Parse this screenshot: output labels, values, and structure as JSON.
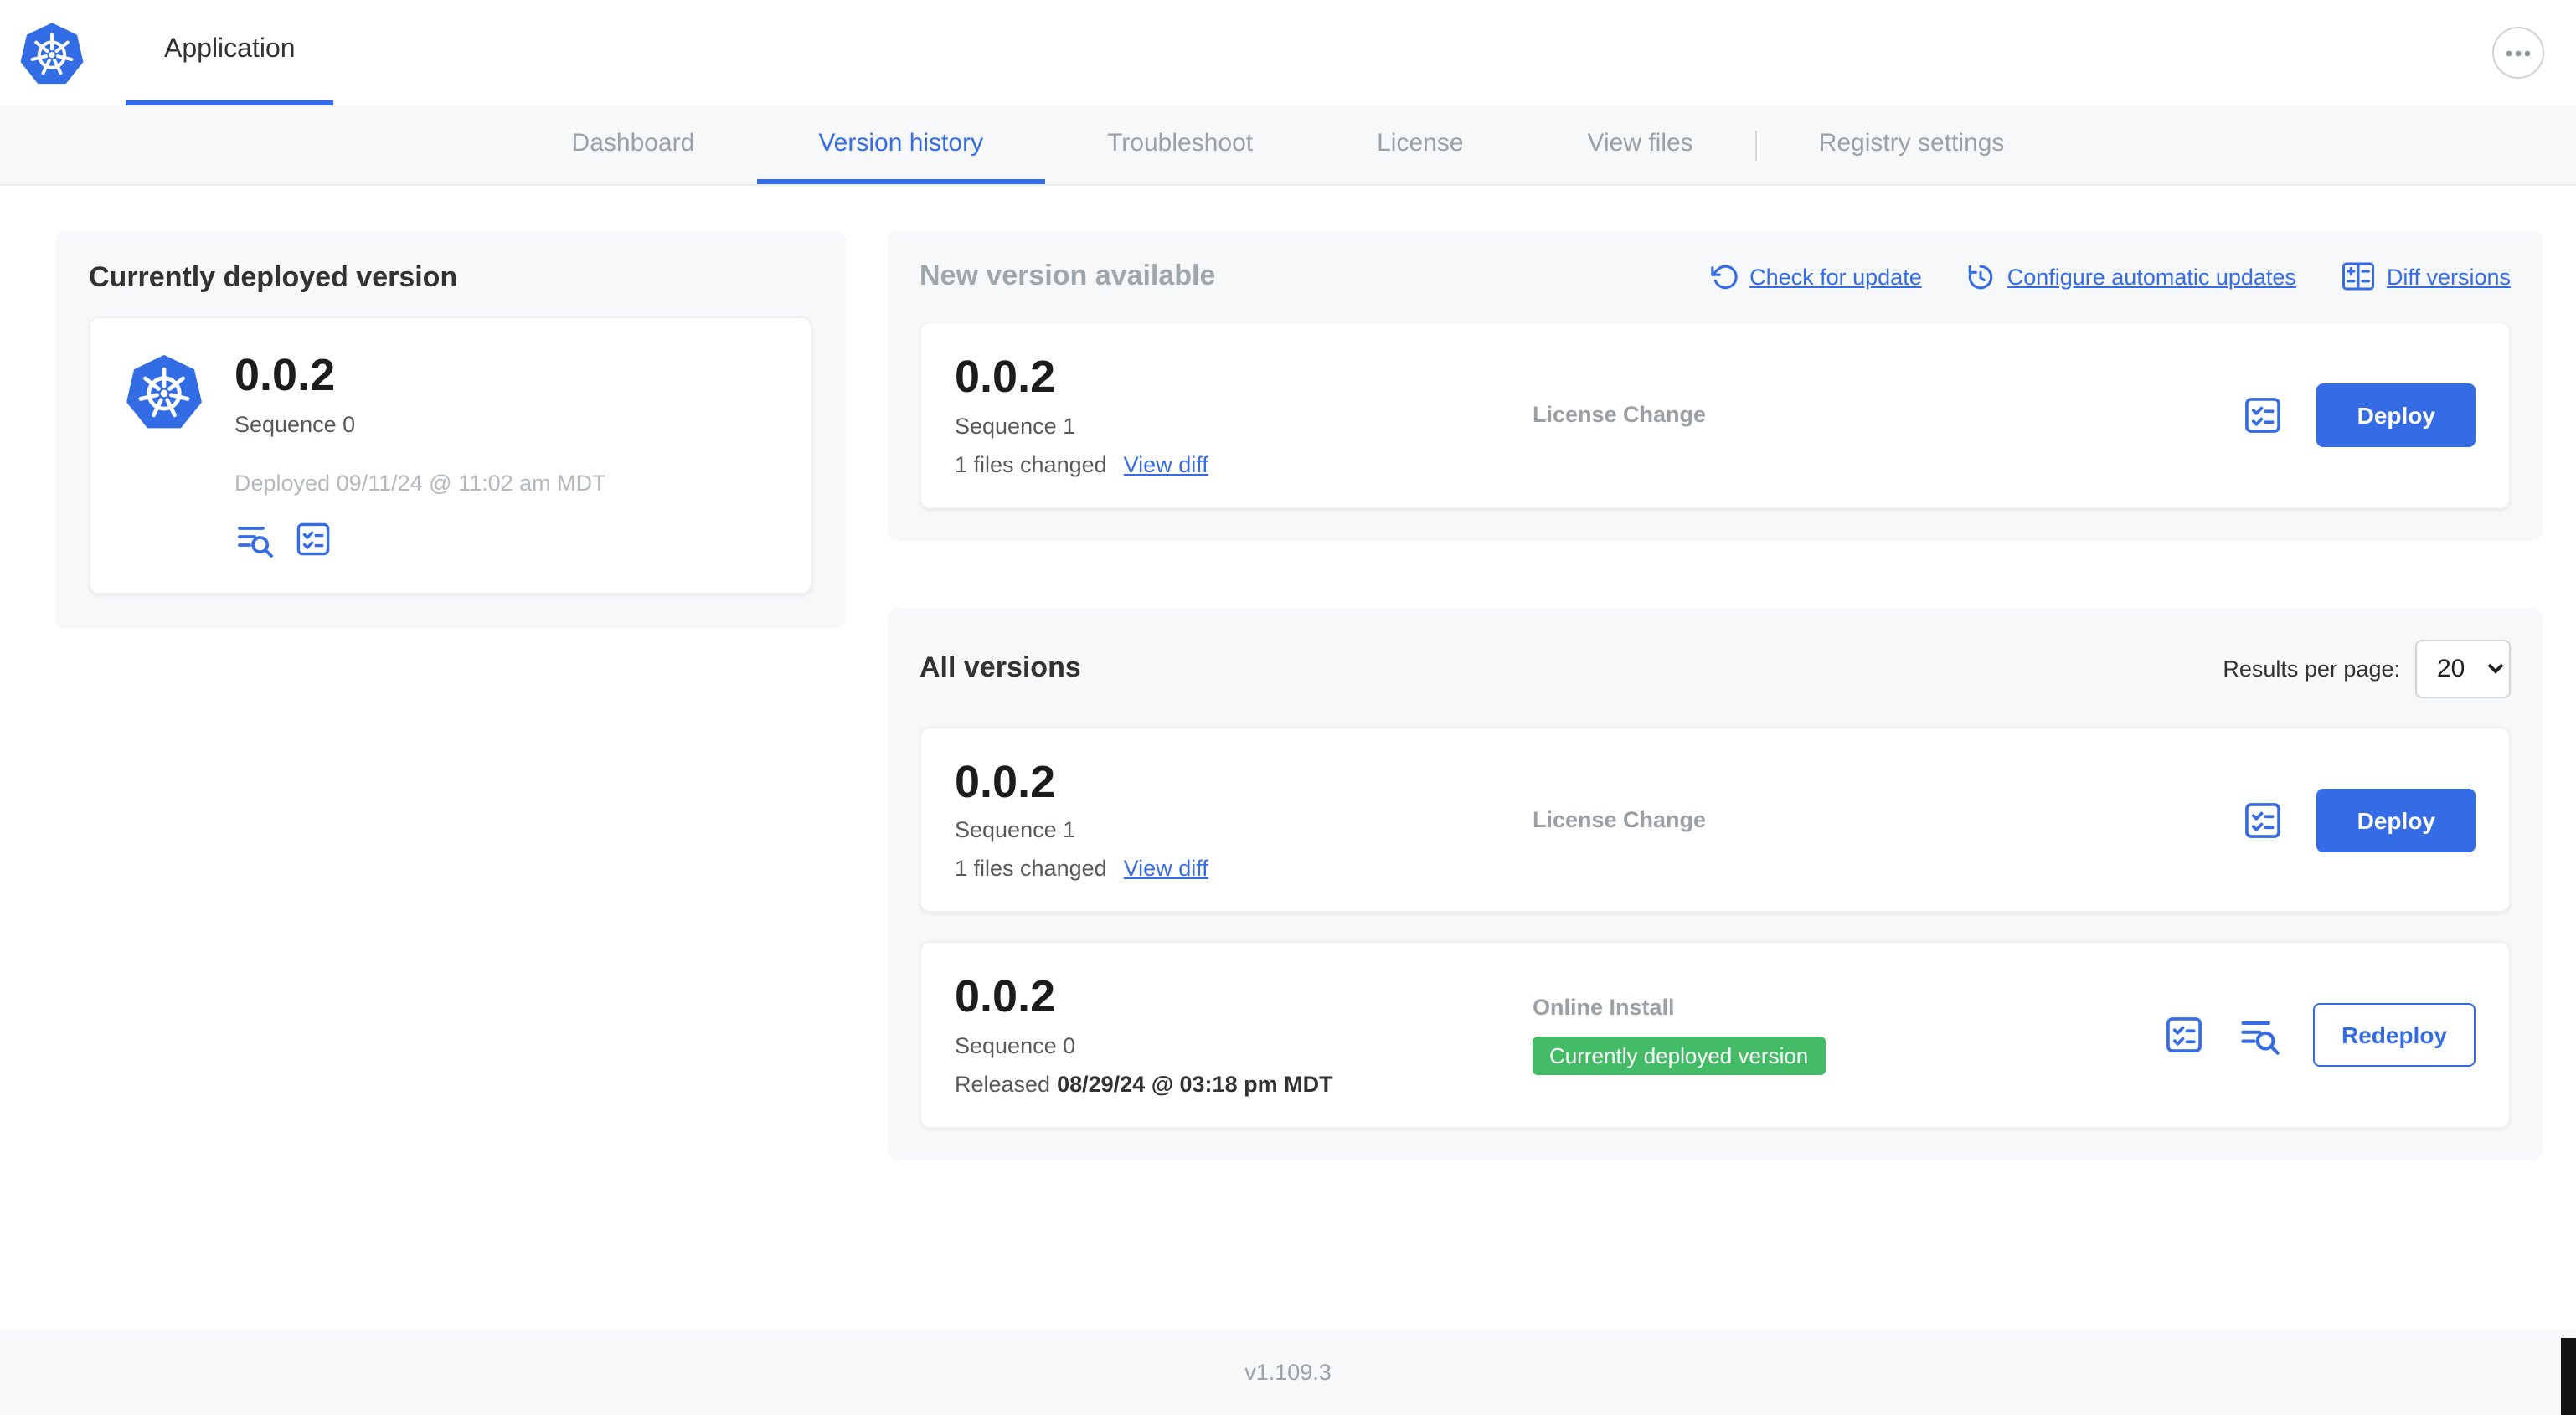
{
  "colors": {
    "accent": "#356ce6",
    "kubernetes_blue": "#326de6",
    "badge_green": "#44bb66",
    "panel_bg": "#f6f8f9"
  },
  "header": {
    "app_label": "Application",
    "logo_icon": "kubernetes-logo-icon",
    "menu_icon": "ellipsis-icon"
  },
  "nav": {
    "tabs": [
      {
        "label": "Dashboard",
        "active": false
      },
      {
        "label": "Version history",
        "active": true
      },
      {
        "label": "Troubleshoot",
        "active": false
      },
      {
        "label": "License",
        "active": false
      },
      {
        "label": "View files",
        "active": false
      },
      {
        "label": "Registry settings",
        "active": false
      }
    ]
  },
  "deployed": {
    "title": "Currently deployed version",
    "version": "0.0.2",
    "sequence": "Sequence 0",
    "deployed_at": "Deployed 09/11/24 @ 11:02 am MDT",
    "icons": [
      "release-notes-icon",
      "config-checklist-icon"
    ]
  },
  "new_version": {
    "title": "New version available",
    "actions": [
      {
        "label": "Check for update",
        "icon": "refresh-ccw-icon"
      },
      {
        "label": "Configure automatic updates",
        "icon": "clock-history-icon"
      },
      {
        "label": "Diff versions",
        "icon": "diff-icon"
      }
    ],
    "row": {
      "version": "0.0.2",
      "sequence": "Sequence 1",
      "files_changed": "1 files changed",
      "view_diff_label": "View diff",
      "change_type": "License Change",
      "icon": "config-checklist-icon",
      "deploy_label": "Deploy"
    }
  },
  "all_versions": {
    "title": "All versions",
    "results_per_page_label": "Results per page:",
    "results_per_page_value": "20",
    "rows": [
      {
        "version": "0.0.2",
        "sequence": "Sequence 1",
        "files_changed": "1 files changed",
        "view_diff_label": "View diff",
        "change_type": "License Change",
        "icons": [
          "config-checklist-icon"
        ],
        "button_label": "Deploy"
      },
      {
        "version": "0.0.2",
        "sequence": "Sequence 0",
        "released_prefix": "Released",
        "released_date": "08/29/24 @ 03:18 pm MDT",
        "change_type": "Online Install",
        "badge": "Currently deployed version",
        "icons": [
          "config-checklist-icon",
          "release-notes-icon"
        ],
        "button_label": "Redeploy"
      }
    ]
  },
  "footer": {
    "version": "v1.109.3"
  }
}
